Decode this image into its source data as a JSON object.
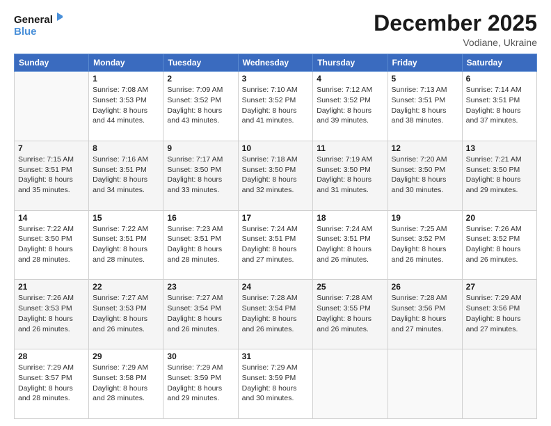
{
  "logo": {
    "line1": "General",
    "line2": "Blue"
  },
  "header": {
    "title": "December 2025",
    "subtitle": "Vodiane, Ukraine"
  },
  "calendar": {
    "days_of_week": [
      "Sunday",
      "Monday",
      "Tuesday",
      "Wednesday",
      "Thursday",
      "Friday",
      "Saturday"
    ],
    "weeks": [
      [
        {
          "day": "",
          "info": ""
        },
        {
          "day": "1",
          "info": "Sunrise: 7:08 AM\nSunset: 3:53 PM\nDaylight: 8 hours\nand 44 minutes."
        },
        {
          "day": "2",
          "info": "Sunrise: 7:09 AM\nSunset: 3:52 PM\nDaylight: 8 hours\nand 43 minutes."
        },
        {
          "day": "3",
          "info": "Sunrise: 7:10 AM\nSunset: 3:52 PM\nDaylight: 8 hours\nand 41 minutes."
        },
        {
          "day": "4",
          "info": "Sunrise: 7:12 AM\nSunset: 3:52 PM\nDaylight: 8 hours\nand 39 minutes."
        },
        {
          "day": "5",
          "info": "Sunrise: 7:13 AM\nSunset: 3:51 PM\nDaylight: 8 hours\nand 38 minutes."
        },
        {
          "day": "6",
          "info": "Sunrise: 7:14 AM\nSunset: 3:51 PM\nDaylight: 8 hours\nand 37 minutes."
        }
      ],
      [
        {
          "day": "7",
          "info": "Sunrise: 7:15 AM\nSunset: 3:51 PM\nDaylight: 8 hours\nand 35 minutes."
        },
        {
          "day": "8",
          "info": "Sunrise: 7:16 AM\nSunset: 3:51 PM\nDaylight: 8 hours\nand 34 minutes."
        },
        {
          "day": "9",
          "info": "Sunrise: 7:17 AM\nSunset: 3:50 PM\nDaylight: 8 hours\nand 33 minutes."
        },
        {
          "day": "10",
          "info": "Sunrise: 7:18 AM\nSunset: 3:50 PM\nDaylight: 8 hours\nand 32 minutes."
        },
        {
          "day": "11",
          "info": "Sunrise: 7:19 AM\nSunset: 3:50 PM\nDaylight: 8 hours\nand 31 minutes."
        },
        {
          "day": "12",
          "info": "Sunrise: 7:20 AM\nSunset: 3:50 PM\nDaylight: 8 hours\nand 30 minutes."
        },
        {
          "day": "13",
          "info": "Sunrise: 7:21 AM\nSunset: 3:50 PM\nDaylight: 8 hours\nand 29 minutes."
        }
      ],
      [
        {
          "day": "14",
          "info": "Sunrise: 7:22 AM\nSunset: 3:50 PM\nDaylight: 8 hours\nand 28 minutes."
        },
        {
          "day": "15",
          "info": "Sunrise: 7:22 AM\nSunset: 3:51 PM\nDaylight: 8 hours\nand 28 minutes."
        },
        {
          "day": "16",
          "info": "Sunrise: 7:23 AM\nSunset: 3:51 PM\nDaylight: 8 hours\nand 28 minutes."
        },
        {
          "day": "17",
          "info": "Sunrise: 7:24 AM\nSunset: 3:51 PM\nDaylight: 8 hours\nand 27 minutes."
        },
        {
          "day": "18",
          "info": "Sunrise: 7:24 AM\nSunset: 3:51 PM\nDaylight: 8 hours\nand 26 minutes."
        },
        {
          "day": "19",
          "info": "Sunrise: 7:25 AM\nSunset: 3:52 PM\nDaylight: 8 hours\nand 26 minutes."
        },
        {
          "day": "20",
          "info": "Sunrise: 7:26 AM\nSunset: 3:52 PM\nDaylight: 8 hours\nand 26 minutes."
        }
      ],
      [
        {
          "day": "21",
          "info": "Sunrise: 7:26 AM\nSunset: 3:53 PM\nDaylight: 8 hours\nand 26 minutes."
        },
        {
          "day": "22",
          "info": "Sunrise: 7:27 AM\nSunset: 3:53 PM\nDaylight: 8 hours\nand 26 minutes."
        },
        {
          "day": "23",
          "info": "Sunrise: 7:27 AM\nSunset: 3:54 PM\nDaylight: 8 hours\nand 26 minutes."
        },
        {
          "day": "24",
          "info": "Sunrise: 7:28 AM\nSunset: 3:54 PM\nDaylight: 8 hours\nand 26 minutes."
        },
        {
          "day": "25",
          "info": "Sunrise: 7:28 AM\nSunset: 3:55 PM\nDaylight: 8 hours\nand 26 minutes."
        },
        {
          "day": "26",
          "info": "Sunrise: 7:28 AM\nSunset: 3:56 PM\nDaylight: 8 hours\nand 27 minutes."
        },
        {
          "day": "27",
          "info": "Sunrise: 7:29 AM\nSunset: 3:56 PM\nDaylight: 8 hours\nand 27 minutes."
        }
      ],
      [
        {
          "day": "28",
          "info": "Sunrise: 7:29 AM\nSunset: 3:57 PM\nDaylight: 8 hours\nand 28 minutes."
        },
        {
          "day": "29",
          "info": "Sunrise: 7:29 AM\nSunset: 3:58 PM\nDaylight: 8 hours\nand 28 minutes."
        },
        {
          "day": "30",
          "info": "Sunrise: 7:29 AM\nSunset: 3:59 PM\nDaylight: 8 hours\nand 29 minutes."
        },
        {
          "day": "31",
          "info": "Sunrise: 7:29 AM\nSunset: 3:59 PM\nDaylight: 8 hours\nand 30 minutes."
        },
        {
          "day": "",
          "info": ""
        },
        {
          "day": "",
          "info": ""
        },
        {
          "day": "",
          "info": ""
        }
      ]
    ]
  }
}
